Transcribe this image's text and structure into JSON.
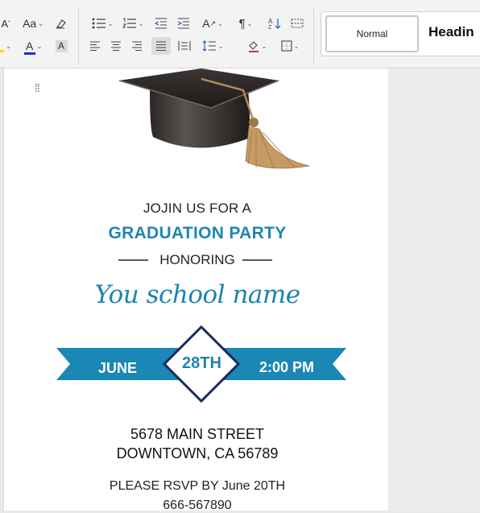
{
  "ribbon": {
    "styles": {
      "normal": "Normal",
      "heading": "Headin"
    }
  },
  "card": {
    "invite": "JOJIN US FOR A",
    "title": "GRADUATION PARTY",
    "honoring": "HONORING",
    "school": "You school name",
    "date": "JUNE",
    "day": "28TH",
    "time": "2:00 PM",
    "address_line1": "5678 MAIN STREET",
    "address_line2": "DOWNTOWN, CA 56789",
    "rsvp": "PLEASE RSVP BY June 20TH",
    "phone": "666-567890"
  },
  "colors": {
    "accent": "#1d84ad",
    "diamond_border": "#1a2a5e",
    "ribbon_band": "#1b87b4"
  }
}
